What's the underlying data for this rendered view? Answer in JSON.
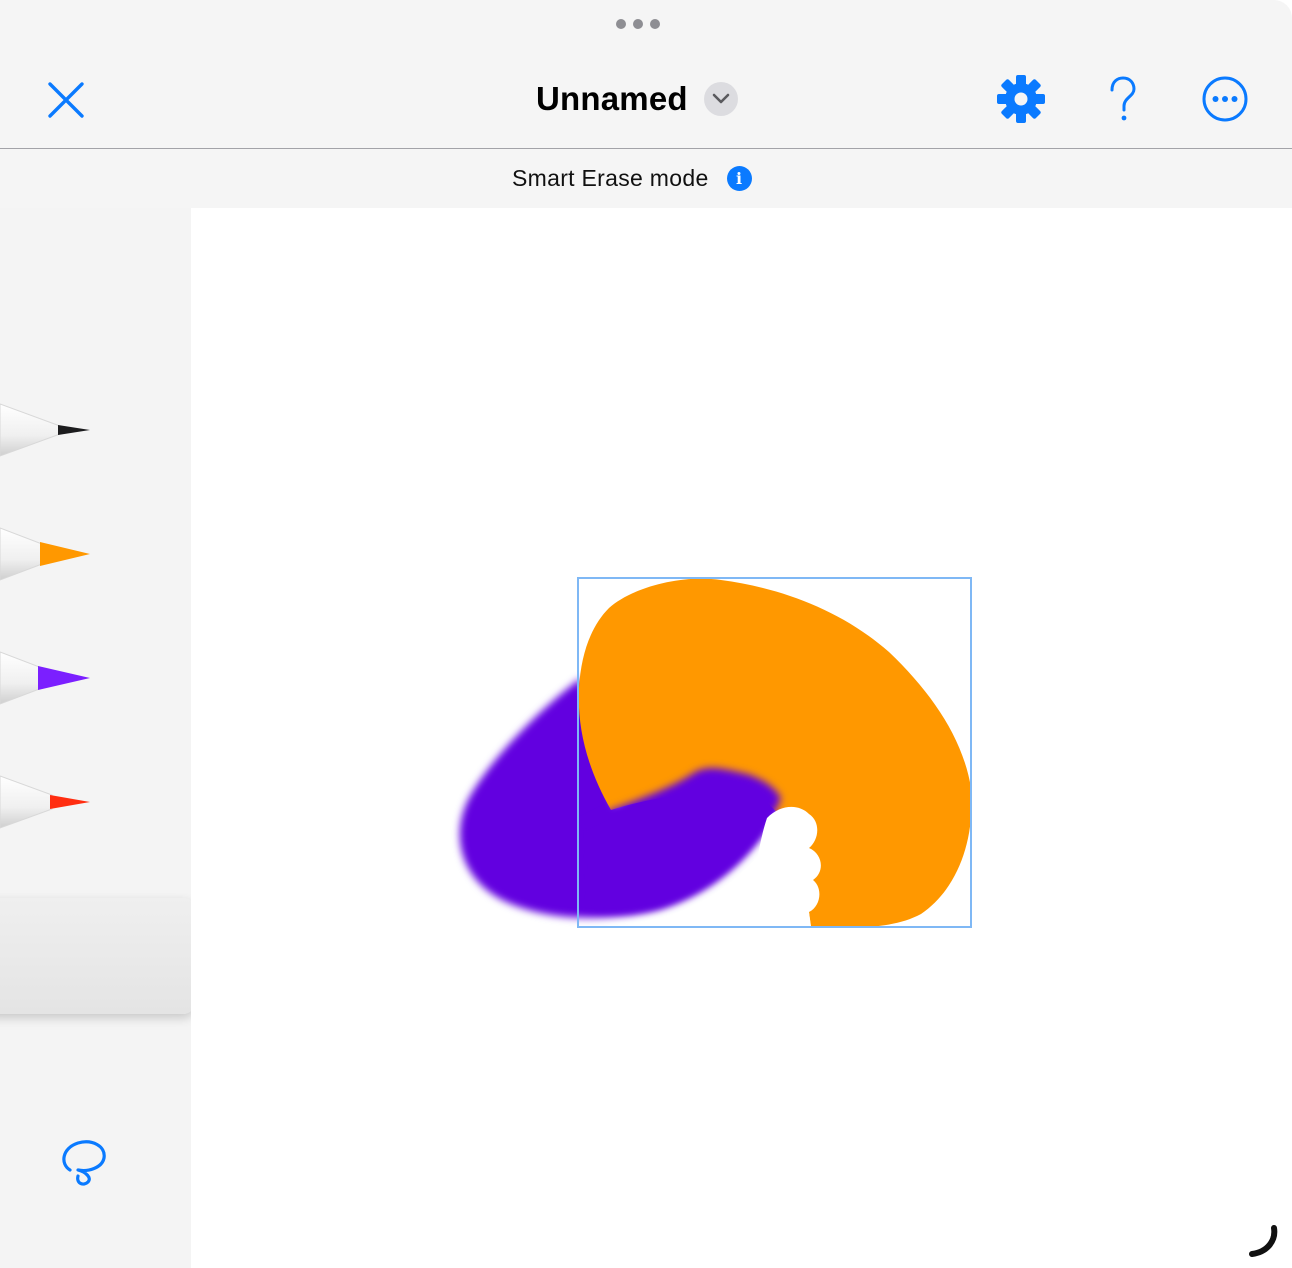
{
  "header": {
    "title": "Unnamed",
    "close_icon": "close-x-icon",
    "title_menu_icon": "chevron-down-icon",
    "settings_icon": "gear-icon",
    "help_icon": "question-mark-icon",
    "more_icon": "ellipsis-circle-icon"
  },
  "mode_bar": {
    "label": "Smart Erase mode",
    "info_icon": "info-circle-icon"
  },
  "sidebar": {
    "pens": [
      {
        "name": "black-pen",
        "color": "#1c1c1e"
      },
      {
        "name": "orange-pen",
        "color": "#ff9800"
      },
      {
        "name": "purple-pen",
        "color": "#7b1fff"
      },
      {
        "name": "red-pen",
        "color": "#ff2d10"
      }
    ],
    "eraser": "eraser-tool",
    "lasso_icon": "lasso-icon"
  },
  "canvas": {
    "strokes": [
      {
        "name": "purple-stroke",
        "color": "#6200e0"
      },
      {
        "name": "orange-shape",
        "color": "#ff9800"
      }
    ],
    "selection_color": "#7fb8f5"
  },
  "colors": {
    "accent": "#0a7aff",
    "chrome_bg": "#f5f5f5"
  }
}
